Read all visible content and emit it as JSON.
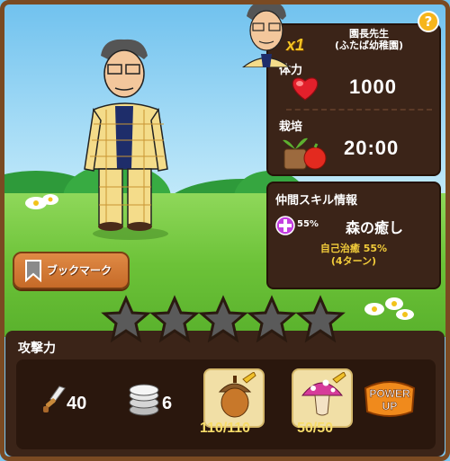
{
  "character": {
    "name_line1": "園長先生",
    "name_line2": "(ふたば幼稚園)",
    "multiplier": "x1"
  },
  "stats": {
    "hp_label": "体力",
    "hp_value": "1000",
    "cultivation_label": "栽培",
    "cultivation_value": "20:00"
  },
  "skill": {
    "title": "仲間スキル情報",
    "percent": "55%",
    "name": "森の癒し",
    "desc_line1": "自己治癒 55%",
    "desc_line2": "(4ターン)"
  },
  "bookmark": {
    "label": "ブックマーク"
  },
  "help": {
    "label": "?"
  },
  "rating": {
    "stars_filled": 0,
    "stars_total": 5
  },
  "attack": {
    "label": "攻撃力",
    "sword_value": "40",
    "coin_value": "6",
    "acorn_value": "110/110",
    "mushroom_value": "50/50"
  },
  "power_up": {
    "line1": "POWER",
    "line2": "UP"
  },
  "colors": {
    "panel": "#3b2418",
    "accent_gold": "#f2cc3a",
    "button_orange": "#d97a36"
  }
}
